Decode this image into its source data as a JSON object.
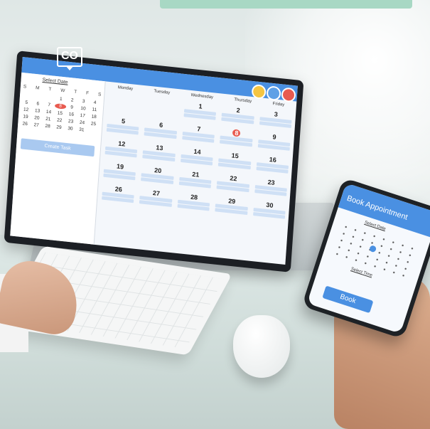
{
  "badge": {
    "text": "CO"
  },
  "laptop": {
    "sidebar": {
      "select_date_label": "Select Date",
      "weekdays": [
        "S",
        "M",
        "T",
        "W",
        "T",
        "F",
        "S"
      ],
      "days": [
        "",
        "",
        "",
        "1",
        "2",
        "3",
        "4",
        "5",
        "6",
        "7",
        "8",
        "9",
        "10",
        "11",
        "12",
        "13",
        "14",
        "15",
        "16",
        "17",
        "18",
        "19",
        "20",
        "21",
        "22",
        "23",
        "24",
        "25",
        "26",
        "27",
        "28",
        "29",
        "30",
        "31"
      ],
      "selected_day": "8",
      "create_button": "Create Task"
    },
    "week_headers": [
      "Monday",
      "Tuesday",
      "Wednesday",
      "Thursday",
      "Friday"
    ],
    "week_days": [
      "",
      "",
      "1",
      "2",
      "3",
      "5",
      "6",
      "7",
      "8",
      "9",
      "12",
      "13",
      "14",
      "15",
      "16",
      "19",
      "20",
      "21",
      "22",
      "23",
      "26",
      "27",
      "28",
      "29",
      "30"
    ],
    "highlighted_day": "8",
    "toolbar_icons": [
      "clock-icon",
      "people-icon",
      "calendar-icon"
    ]
  },
  "phone": {
    "title": "Book Appointment",
    "select_date_label": "Select Date",
    "select_time_label": "Select Time",
    "book_button": "Book"
  }
}
